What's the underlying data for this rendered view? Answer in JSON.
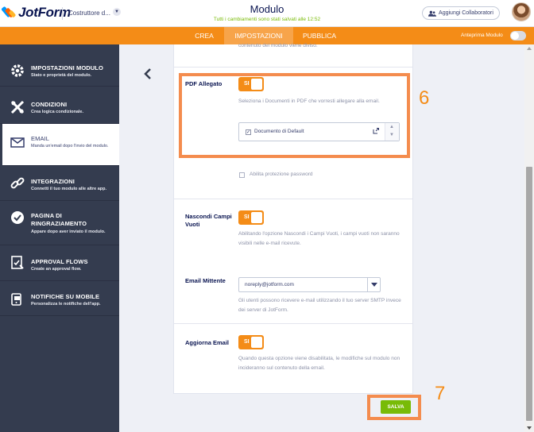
{
  "header": {
    "logo_text": "JotForm",
    "builder_label": "Costruttore d...",
    "form_title": "Modulo",
    "save_status": "Tutti i cambiamenti sono stati salvati alle 12:52",
    "collaborators_button": "Aggiungi Collaboratori"
  },
  "nav": {
    "tabs": [
      {
        "label": "CREA"
      },
      {
        "label": "IMPOSTAZIONI"
      },
      {
        "label": "PUBBLICA"
      }
    ],
    "preview_label": "Anteprima Modulo"
  },
  "sidebar": {
    "items": [
      {
        "title": "IMPOSTAZIONI MODULO",
        "subtitle": "Stato e proprietà del modulo.",
        "icon": "gear-icon"
      },
      {
        "title": "CONDIZIONI",
        "subtitle": "Crea logica condizionale.",
        "icon": "conditions-icon"
      },
      {
        "title": "EMAIL",
        "subtitle": "Manda un'email dopo l'invio del modulo.",
        "icon": "envelope-icon"
      },
      {
        "title": "INTEGRAZIONI",
        "subtitle": "Connetti il tuo modulo alle altre app.",
        "icon": "link-icon"
      },
      {
        "title": "PAGINA DI RINGRAZIAMENTO",
        "subtitle": "Appare dopo aver inviato il modulo.",
        "icon": "check-circle-icon"
      },
      {
        "title": "APPROVAL FLOWS",
        "subtitle": "Create an approval flow.",
        "icon": "approval-icon"
      },
      {
        "title": "NOTIFICHE SU MOBILE",
        "subtitle": "Personalizza le notifiche dell'app.",
        "icon": "mobile-icon"
      }
    ]
  },
  "settings": {
    "truncated_text": "contenuto del modulo viene diviso.",
    "pdf": {
      "label": "PDF Allegato",
      "toggle": "SI",
      "description": "Seleziona i Documenti in PDF che vorresti allegare alla email.",
      "document": "Documento di Default",
      "password_label": "Abilita protezione password"
    },
    "hide_empty": {
      "label": "Nascondi Campi Vuoti",
      "toggle": "SI",
      "description": "Abilitando l'opzione Nascondi i Campi Vuoti, i campi vuoti non saranno visibili nelle e-mail ricevute."
    },
    "sender": {
      "label": "Email Mittente",
      "value": "noreply@jotform.com",
      "description": "Gli utenti possono ricevere e-mail utilizzando il tuo server SMTP invece dei server di JotForm."
    },
    "update_email": {
      "label": "Aggiorna Email",
      "toggle": "SI",
      "description": "Quando questa opzione viene disabilitata, le modifiche sul modulo non incideranno sul contenuto della email."
    },
    "save_button": "SALVA"
  },
  "annotations": {
    "box_6": "6",
    "box_7": "7",
    "color": "#f48c4e"
  },
  "colors": {
    "accent": "#f48c17",
    "sidebar": "#343c4f",
    "save": "#78bb07"
  }
}
